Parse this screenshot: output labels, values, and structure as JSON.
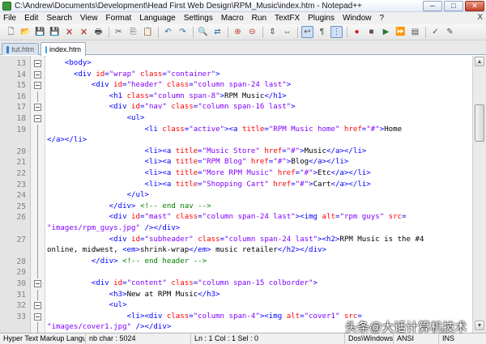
{
  "window": {
    "title": "C:\\Andrew\\Documents\\Development\\Head First Web Design\\RPM_Music\\index.htm - Notepad++",
    "buttons": [
      "─",
      "□",
      "✕"
    ]
  },
  "menu": {
    "items": [
      "File",
      "Edit",
      "Search",
      "View",
      "Format",
      "Language",
      "Settings",
      "Macro",
      "Run",
      "TextFX",
      "Plugins",
      "Window",
      "?"
    ],
    "close": "X"
  },
  "toolbar": {
    "icons": [
      "new-icon",
      "open-icon",
      "save-icon",
      "save-all-icon",
      "close-icon",
      "close-all-icon",
      "print-icon",
      "sep",
      "cut-icon",
      "copy-icon",
      "paste-icon",
      "sep",
      "undo-icon",
      "redo-icon",
      "sep",
      "find-icon",
      "replace-icon",
      "sep",
      "zoom-in-icon",
      "zoom-out-icon",
      "sep",
      "sync-v-icon",
      "sync-h-icon",
      "sep",
      "wrap-icon",
      "all-chars-icon",
      "indent-guide-icon",
      "sep",
      "record-icon",
      "stop-icon",
      "play-icon",
      "play-multi-icon",
      "save-macro-icon",
      "sep",
      "spell-icon",
      "abc-icon"
    ],
    "glyphs": {
      "new-icon": "🗋",
      "open-icon": "📂",
      "save-icon": "💾",
      "save-all-icon": "💾",
      "close-icon": "🗙",
      "close-all-icon": "🗙",
      "print-icon": "🖶",
      "cut-icon": "✂",
      "copy-icon": "⎘",
      "paste-icon": "📋",
      "undo-icon": "↶",
      "redo-icon": "↷",
      "find-icon": "🔍",
      "replace-icon": "⇄",
      "zoom-in-icon": "⊕",
      "zoom-out-icon": "⊖",
      "sync-v-icon": "⇕",
      "sync-h-icon": "⇔",
      "wrap-icon": "↩",
      "all-chars-icon": "¶",
      "indent-guide-icon": "⋮",
      "record-icon": "●",
      "stop-icon": "■",
      "play-icon": "▶",
      "play-multi-icon": "⏩",
      "save-macro-icon": "▤",
      "spell-icon": "✓",
      "abc-icon": "✎"
    },
    "colors": {
      "record-icon": "#d01818",
      "stop-icon": "#555555",
      "play-icon": "#2a7a2a",
      "play-multi-icon": "#2a7a2a",
      "undo-icon": "#2a6ab0",
      "redo-icon": "#2a6ab0",
      "find-icon": "#3a6aa8",
      "replace-icon": "#3a6aa8",
      "zoom-in-icon": "#c0392b",
      "zoom-out-icon": "#c0392b",
      "save-icon": "#2f5fa0",
      "save-all-icon": "#2f5fa0",
      "close-icon": "#b03030",
      "close-all-icon": "#b03030"
    },
    "active": [
      "wrap-icon",
      "indent-guide-icon"
    ]
  },
  "tabs": [
    {
      "label": "tut.htm",
      "active": false
    },
    {
      "label": "index.htm",
      "active": true
    }
  ],
  "editor": {
    "lines": [
      {
        "n": "13",
        "fold": "box",
        "segs": [
          [
            "tx",
            "    "
          ],
          [
            "tg",
            "<body>"
          ]
        ]
      },
      {
        "n": "14",
        "fold": "box",
        "segs": [
          [
            "tx",
            "      "
          ],
          [
            "tg",
            "<div "
          ],
          [
            "at",
            "id"
          ],
          [
            "tg",
            "="
          ],
          [
            "av",
            "\"wrap\""
          ],
          [
            "tg",
            " "
          ],
          [
            "at",
            "class"
          ],
          [
            "tg",
            "="
          ],
          [
            "av",
            "\"container\""
          ],
          [
            "tg",
            ">"
          ]
        ]
      },
      {
        "n": "15",
        "fold": "box",
        "segs": [
          [
            "tx",
            "          "
          ],
          [
            "tg",
            "<div "
          ],
          [
            "at",
            "id"
          ],
          [
            "tg",
            "="
          ],
          [
            "av",
            "\"header\""
          ],
          [
            "tg",
            " "
          ],
          [
            "at",
            "class"
          ],
          [
            "tg",
            "="
          ],
          [
            "av",
            "\"column span-24 last\""
          ],
          [
            "tg",
            ">"
          ]
        ]
      },
      {
        "n": "16",
        "fold": "line",
        "segs": [
          [
            "tx",
            "              "
          ],
          [
            "tg",
            "<h1 "
          ],
          [
            "at",
            "class"
          ],
          [
            "tg",
            "="
          ],
          [
            "av",
            "\"column span-8\""
          ],
          [
            "tg",
            ">"
          ],
          [
            "tx",
            "RPM Music"
          ],
          [
            "tg",
            "</h1>"
          ]
        ]
      },
      {
        "n": "17",
        "fold": "box",
        "segs": [
          [
            "tx",
            "              "
          ],
          [
            "tg",
            "<div "
          ],
          [
            "at",
            "id"
          ],
          [
            "tg",
            "="
          ],
          [
            "av",
            "\"nav\""
          ],
          [
            "tg",
            " "
          ],
          [
            "at",
            "class"
          ],
          [
            "tg",
            "="
          ],
          [
            "av",
            "\"column span-16 last\""
          ],
          [
            "tg",
            ">"
          ]
        ]
      },
      {
        "n": "18",
        "fold": "box",
        "segs": [
          [
            "tx",
            "                  "
          ],
          [
            "tg",
            "<ul>"
          ]
        ]
      },
      {
        "n": "19",
        "fold": "line",
        "segs": [
          [
            "tx",
            "                      "
          ],
          [
            "tg",
            "<li "
          ],
          [
            "at",
            "class"
          ],
          [
            "tg",
            "="
          ],
          [
            "av",
            "\"active\""
          ],
          [
            "tg",
            "><a "
          ],
          [
            "at",
            "title"
          ],
          [
            "tg",
            "="
          ],
          [
            "av",
            "\"RPM Music home\""
          ],
          [
            "tg",
            " "
          ],
          [
            "at",
            "href"
          ],
          [
            "tg",
            "="
          ],
          [
            "av",
            "\"#\""
          ],
          [
            "tg",
            ">"
          ],
          [
            "tx",
            "Home"
          ]
        ]
      },
      {
        "n": "",
        "fold": "line",
        "segs": [
          [
            "tg",
            "</a></li>"
          ]
        ]
      },
      {
        "n": "20",
        "fold": "line",
        "segs": [
          [
            "tx",
            "                      "
          ],
          [
            "tg",
            "<li><a "
          ],
          [
            "at",
            "title"
          ],
          [
            "tg",
            "="
          ],
          [
            "av",
            "\"Music Store\""
          ],
          [
            "tg",
            " "
          ],
          [
            "at",
            "href"
          ],
          [
            "tg",
            "="
          ],
          [
            "av",
            "\"#\""
          ],
          [
            "tg",
            ">"
          ],
          [
            "tx",
            "Music"
          ],
          [
            "tg",
            "</a></li>"
          ]
        ]
      },
      {
        "n": "21",
        "fold": "line",
        "segs": [
          [
            "tx",
            "                      "
          ],
          [
            "tg",
            "<li><a "
          ],
          [
            "at",
            "title"
          ],
          [
            "tg",
            "="
          ],
          [
            "av",
            "\"RPM Blog\""
          ],
          [
            "tg",
            " "
          ],
          [
            "at",
            "href"
          ],
          [
            "tg",
            "="
          ],
          [
            "av",
            "\"#\""
          ],
          [
            "tg",
            ">"
          ],
          [
            "tx",
            "Blog"
          ],
          [
            "tg",
            "</a></li>"
          ]
        ]
      },
      {
        "n": "22",
        "fold": "line",
        "segs": [
          [
            "tx",
            "                      "
          ],
          [
            "tg",
            "<li><a "
          ],
          [
            "at",
            "title"
          ],
          [
            "tg",
            "="
          ],
          [
            "av",
            "\"More RPM Music\""
          ],
          [
            "tg",
            " "
          ],
          [
            "at",
            "href"
          ],
          [
            "tg",
            "="
          ],
          [
            "av",
            "\"#\""
          ],
          [
            "tg",
            ">"
          ],
          [
            "tx",
            "Etc"
          ],
          [
            "tg",
            "</a></li>"
          ]
        ]
      },
      {
        "n": "23",
        "fold": "line",
        "segs": [
          [
            "tx",
            "                      "
          ],
          [
            "tg",
            "<li><a "
          ],
          [
            "at",
            "title"
          ],
          [
            "tg",
            "="
          ],
          [
            "av",
            "\"Shopping Cart\""
          ],
          [
            "tg",
            " "
          ],
          [
            "at",
            "href"
          ],
          [
            "tg",
            "="
          ],
          [
            "av",
            "\"#\""
          ],
          [
            "tg",
            ">"
          ],
          [
            "tx",
            "Cart"
          ],
          [
            "tg",
            "</a></li>"
          ]
        ]
      },
      {
        "n": "24",
        "fold": "line",
        "segs": [
          [
            "tx",
            "                  "
          ],
          [
            "tg",
            "</ul>"
          ]
        ]
      },
      {
        "n": "25",
        "fold": "line",
        "segs": [
          [
            "tx",
            "              "
          ],
          [
            "tg",
            "</div>"
          ],
          [
            "tx",
            " "
          ],
          [
            "cm",
            "<!-- end nav -->"
          ]
        ]
      },
      {
        "n": "26",
        "fold": "line",
        "segs": [
          [
            "tx",
            "              "
          ],
          [
            "tg",
            "<div "
          ],
          [
            "at",
            "id"
          ],
          [
            "tg",
            "="
          ],
          [
            "av",
            "\"mast\""
          ],
          [
            "tg",
            " "
          ],
          [
            "at",
            "class"
          ],
          [
            "tg",
            "="
          ],
          [
            "av",
            "\"column span-24 last\""
          ],
          [
            "tg",
            "><img "
          ],
          [
            "at",
            "alt"
          ],
          [
            "tg",
            "="
          ],
          [
            "av",
            "\"rpm guys\""
          ],
          [
            "tg",
            " "
          ],
          [
            "at",
            "src"
          ],
          [
            "tg",
            "="
          ]
        ]
      },
      {
        "n": "",
        "fold": "line",
        "segs": [
          [
            "av",
            "\"images/rpm_guys.jpg\""
          ],
          [
            "tg",
            " />"
          ],
          [
            "tg",
            "</div>"
          ]
        ]
      },
      {
        "n": "27",
        "fold": "line",
        "segs": [
          [
            "tx",
            "              "
          ],
          [
            "tg",
            "<div "
          ],
          [
            "at",
            "id"
          ],
          [
            "tg",
            "="
          ],
          [
            "av",
            "\"subheader\""
          ],
          [
            "tg",
            " "
          ],
          [
            "at",
            "class"
          ],
          [
            "tg",
            "="
          ],
          [
            "av",
            "\"column span-24 last\""
          ],
          [
            "tg",
            "><h2>"
          ],
          [
            "tx",
            "RPM Music is the #4"
          ]
        ]
      },
      {
        "n": "",
        "fold": "line",
        "segs": [
          [
            "tx",
            "online, midwest, "
          ],
          [
            "tg",
            "<em>"
          ],
          [
            "tx",
            "shrink-wrap"
          ],
          [
            "tg",
            "</em>"
          ],
          [
            "tx",
            " music retailer"
          ],
          [
            "tg",
            "</h2></div>"
          ]
        ]
      },
      {
        "n": "28",
        "fold": "line",
        "segs": [
          [
            "tx",
            "          "
          ],
          [
            "tg",
            "</div>"
          ],
          [
            "tx",
            " "
          ],
          [
            "cm",
            "<!-- end header -->"
          ]
        ]
      },
      {
        "n": "29",
        "fold": "line",
        "segs": [
          [
            "tx",
            ""
          ]
        ]
      },
      {
        "n": "30",
        "fold": "box",
        "segs": [
          [
            "tx",
            "          "
          ],
          [
            "tg",
            "<div "
          ],
          [
            "at",
            "id"
          ],
          [
            "tg",
            "="
          ],
          [
            "av",
            "\"content\""
          ],
          [
            "tg",
            " "
          ],
          [
            "at",
            "class"
          ],
          [
            "tg",
            "="
          ],
          [
            "av",
            "\"column span-15 colborder\""
          ],
          [
            "tg",
            ">"
          ]
        ]
      },
      {
        "n": "31",
        "fold": "line",
        "segs": [
          [
            "tx",
            "              "
          ],
          [
            "tg",
            "<h3>"
          ],
          [
            "tx",
            "New at RPM Music"
          ],
          [
            "tg",
            "</h3>"
          ]
        ]
      },
      {
        "n": "32",
        "fold": "box",
        "segs": [
          [
            "tx",
            "              "
          ],
          [
            "tg",
            "<ul>"
          ]
        ]
      },
      {
        "n": "33",
        "fold": "box",
        "segs": [
          [
            "tx",
            "                  "
          ],
          [
            "tg",
            "<li><div "
          ],
          [
            "at",
            "class"
          ],
          [
            "tg",
            "="
          ],
          [
            "av",
            "\"column span-4\""
          ],
          [
            "tg",
            "><img "
          ],
          [
            "at",
            "alt"
          ],
          [
            "tg",
            "="
          ],
          [
            "av",
            "\"cover1\""
          ],
          [
            "tg",
            " "
          ],
          [
            "at",
            "src"
          ],
          [
            "tg",
            "="
          ]
        ]
      },
      {
        "n": "",
        "fold": "line",
        "segs": [
          [
            "av",
            "\"images/cover1.jpg\""
          ],
          [
            "tg",
            " />"
          ],
          [
            "tg",
            "</div>"
          ]
        ]
      }
    ]
  },
  "scrollbar": {
    "up": "▲",
    "down": "▼"
  },
  "status": {
    "type": "Hyper Text Markup Langu",
    "length": "nb char : 5024",
    "position": "Ln : 1   Col : 1   Sel : 0",
    "eol": "Dos\\Windows",
    "encoding": "ANSI",
    "mode": "INS"
  },
  "watermark": "头条@大话计算机技术"
}
